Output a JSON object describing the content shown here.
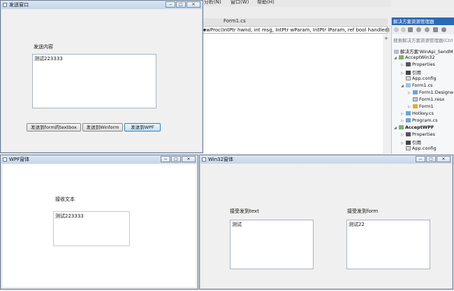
{
  "vs": {
    "menus": [
      "分析(N)",
      "窗口(W)",
      "帮助(H)"
    ],
    "tab": "Form1.cs",
    "codebar": "owProc(IntPtr hwnd, int msg, IntPtr wParam, IntPtr lParam, ref bool handled)"
  },
  "solution_explorer": {
    "title": "解决方案资源管理器",
    "search_placeholder": "搜索解决方案资源管理器(Ctrl+",
    "items": [
      {
        "label": "解决方案'WinApi_SendM",
        "expanded": true
      },
      {
        "label": "AcceptWin32",
        "expanded": true
      },
      {
        "label": "Properties",
        "expanded": false
      },
      {
        "label": "引用",
        "expanded": false
      },
      {
        "label": "App.config",
        "expanded": null
      },
      {
        "label": "Form1.cs",
        "expanded": true
      },
      {
        "label": "Form1.Designe",
        "expanded": false
      },
      {
        "label": "Form1.resx",
        "expanded": null
      },
      {
        "label": "Form1",
        "expanded": false
      },
      {
        "label": "Hotkey.cs",
        "expanded": false
      },
      {
        "label": "Program.cs",
        "expanded": false
      },
      {
        "label": "AcceptWPF",
        "expanded": true
      },
      {
        "label": "Properties",
        "expanded": false
      },
      {
        "label": "引用",
        "expanded": false
      },
      {
        "label": "App.config",
        "expanded": null
      }
    ]
  },
  "send_window": {
    "title": "发送窗口",
    "content_label": "发送内容",
    "content_value": "测试223333",
    "buttons": [
      "发送到form的textbox",
      "发送到Winform",
      "发送到WPF"
    ]
  },
  "wpf_window": {
    "title": "WPF窗体",
    "receive_label": "接收文本",
    "receive_value": "测试223333"
  },
  "win32_window": {
    "title": "Win32窗体",
    "text_label": "接受发到text",
    "text_value": "测试",
    "form_label": "接受发到form",
    "form_value": "测试22"
  },
  "window_buttons": {
    "minimize": "−",
    "maximize": "□",
    "close": "✕"
  }
}
